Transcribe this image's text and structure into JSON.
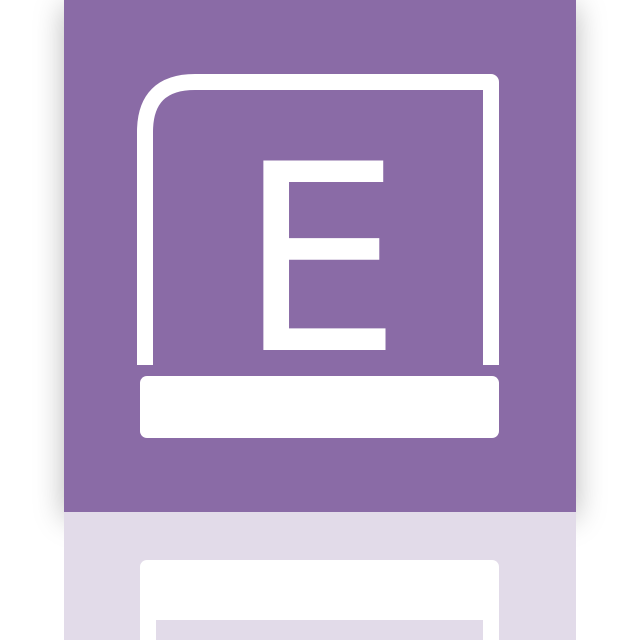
{
  "tile": {
    "glyph": "E",
    "colors": {
      "tile_background": "#8a6ba6",
      "foreground": "#ffffff",
      "reflection_background": "#e2dbe9"
    }
  },
  "icon": {
    "name": "drive-e-icon"
  }
}
